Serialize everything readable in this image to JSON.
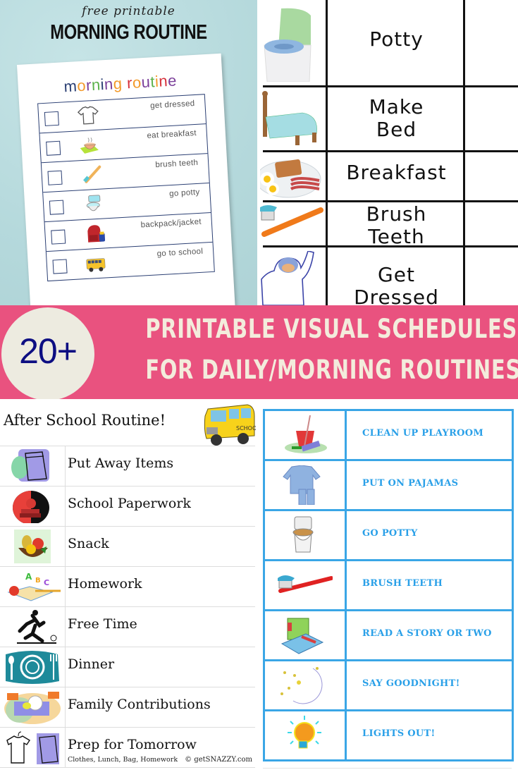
{
  "top_left": {
    "kicker": "free printable",
    "heading": "MORNING ROUTINE",
    "sheet_title_letters": [
      {
        "ch": "m",
        "color": "#2b3f73"
      },
      {
        "ch": "o",
        "color": "#f39a2a"
      },
      {
        "ch": "r",
        "color": "#7b3f9a"
      },
      {
        "ch": "n",
        "color": "#5bb14a"
      },
      {
        "ch": "i",
        "color": "#2b3f73"
      },
      {
        "ch": "n",
        "color": "#7b3f9a"
      },
      {
        "ch": "g",
        "color": "#f39a2a"
      },
      {
        "ch": " ",
        "color": "#000000"
      },
      {
        "ch": "r",
        "color": "#d6303a"
      },
      {
        "ch": "o",
        "color": "#f39a2a"
      },
      {
        "ch": "u",
        "color": "#7b3f9a"
      },
      {
        "ch": "t",
        "color": "#5bb14a"
      },
      {
        "ch": "i",
        "color": "#f39a2a"
      },
      {
        "ch": "n",
        "color": "#d6303a"
      },
      {
        "ch": "e",
        "color": "#7b3f9a"
      }
    ],
    "items": [
      {
        "label": "get dressed",
        "icon": "tshirt-icon"
      },
      {
        "label": "eat breakfast",
        "icon": "cereal-bowl-icon"
      },
      {
        "label": "brush teeth",
        "icon": "toothbrush-icon"
      },
      {
        "label": "go potty",
        "icon": "toilet-icon"
      },
      {
        "label": "backpack/jacket",
        "icon": "backpack-icon"
      },
      {
        "label": "go to school",
        "icon": "school-bus-icon"
      }
    ]
  },
  "top_right": {
    "items": [
      {
        "label": "Potty",
        "icon": "potty-chair-icon"
      },
      {
        "label": "Make\nBed",
        "line1": "Make",
        "line2": "Bed",
        "icon": "bed-icon"
      },
      {
        "label": "Breakfast",
        "icon": "breakfast-plate-icon"
      },
      {
        "label": "Brush\nTeeth",
        "line1": "Brush",
        "line2": "Teeth",
        "icon": "toothbrush-icon"
      },
      {
        "label": "Get\nDressed",
        "line1": "Get",
        "line2": "Dressed",
        "icon": "pajama-child-icon"
      }
    ]
  },
  "banner": {
    "count": "20+",
    "line1": "PRINTABLE VISUAL SCHEDULES",
    "line2": "FOR DAILY/MORNING ROUTINES",
    "colors": {
      "background": "#e9527f",
      "circle": "#edebe0",
      "count": "#0d0e82",
      "text": "#f3ecdc"
    }
  },
  "bottom_left": {
    "title": "After School Routine!",
    "title_icon": "school-bus-icon",
    "items": [
      {
        "label": "Put Away Items",
        "icon": "backpack-icon"
      },
      {
        "label": "School Paperwork",
        "icon": "books-apple-icon"
      },
      {
        "label": "Snack",
        "icon": "fruit-basket-icon"
      },
      {
        "label": "Homework",
        "icon": "abc-book-icon"
      },
      {
        "label": "Free Time",
        "icon": "running-child-icon"
      },
      {
        "label": "Dinner",
        "icon": "plate-cutlery-icon"
      },
      {
        "label": "Family Contributions",
        "icon": "washing-dishes-icon"
      },
      {
        "label": "Prep for Tomorrow",
        "icon": "clothes-bag-icon",
        "sub": "Clothes, Lunch, Bag, Homework"
      }
    ],
    "copyright": "© getSNAZZY.com"
  },
  "bottom_right": {
    "items": [
      {
        "label": "CLEAN UP PLAYROOM",
        "icon": "cleaning-bucket-icon"
      },
      {
        "label": "PUT ON PAJAMAS",
        "icon": "pajamas-icon"
      },
      {
        "label": "GO POTTY",
        "icon": "toilet-icon"
      },
      {
        "label": "BRUSH TEETH",
        "icon": "toothbrush-icon"
      },
      {
        "label": "READ A STORY OR TWO",
        "icon": "books-icon"
      },
      {
        "label": "SAY GOODNIGHT!",
        "icon": "moon-stars-icon"
      },
      {
        "label": "LIGHTS OUT!",
        "icon": "light-bulb-icon"
      }
    ],
    "colors": {
      "grid": "#3aa6e6",
      "text": "#2aa0e8"
    }
  }
}
